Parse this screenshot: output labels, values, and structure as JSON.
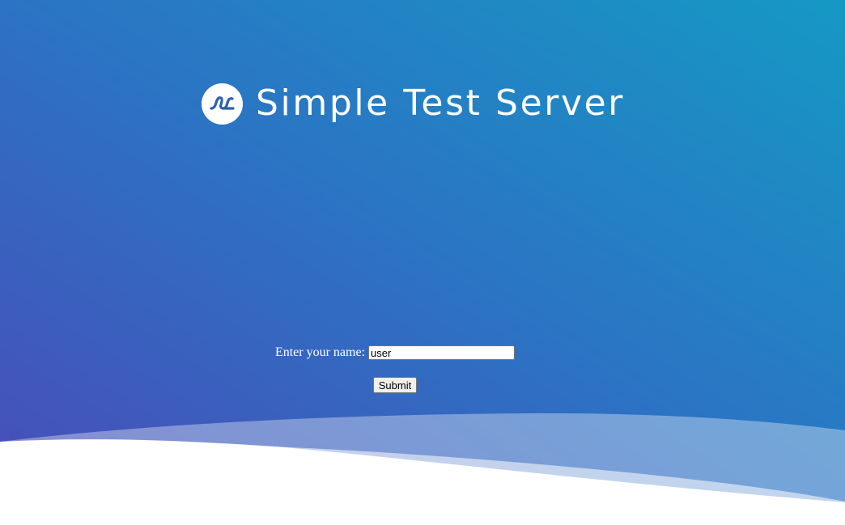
{
  "header": {
    "title": "Simple Test Server",
    "logo_icon": "wave-logo-icon"
  },
  "form": {
    "name_label": "Enter your name:",
    "name_value": "user",
    "submit_label": "Submit"
  },
  "colors": {
    "gradient_start": "#4a4bb8",
    "gradient_mid": "#2c73c4",
    "gradient_end": "#1599c4",
    "text": "#ffffff"
  }
}
